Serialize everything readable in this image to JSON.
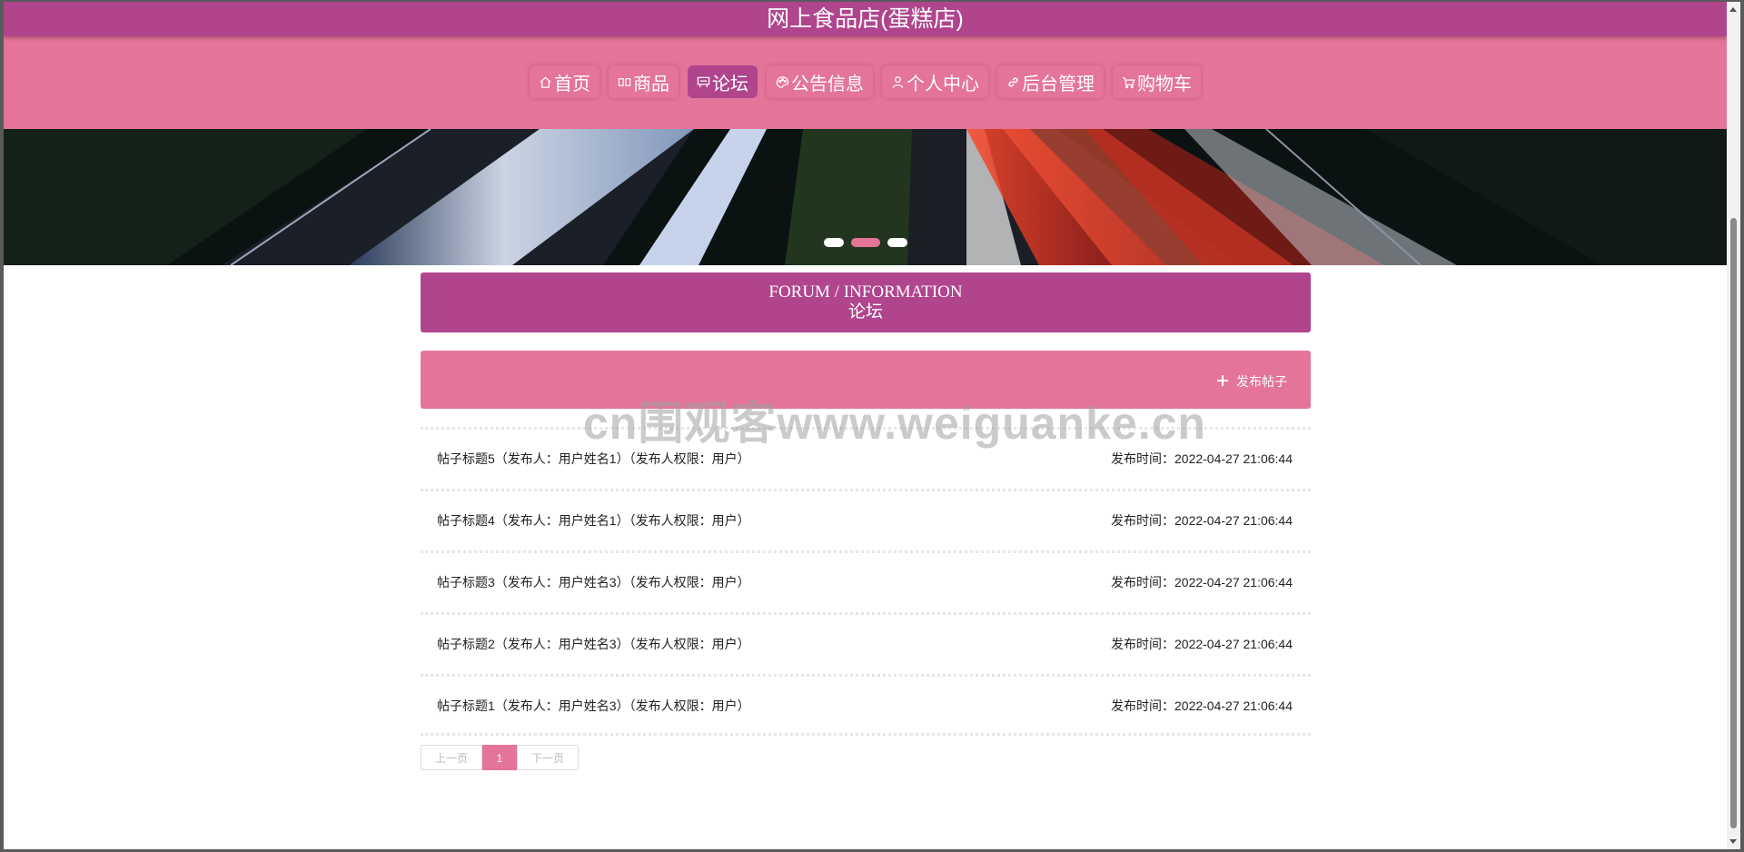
{
  "site": {
    "title": "网上食品店(蛋糕店)"
  },
  "nav": {
    "items": [
      {
        "label": "首页",
        "icon": "home-icon",
        "active": false
      },
      {
        "label": "商品",
        "icon": "goods-icon",
        "active": false
      },
      {
        "label": "论坛",
        "icon": "forum-icon",
        "active": true
      },
      {
        "label": "公告信息",
        "icon": "palette-icon",
        "active": false
      },
      {
        "label": "个人中心",
        "icon": "user-icon",
        "active": false
      },
      {
        "label": "后台管理",
        "icon": "link-icon",
        "active": false
      },
      {
        "label": "购物车",
        "icon": "cart-icon",
        "active": false
      }
    ]
  },
  "banner": {
    "slide_count": 3,
    "active_slide": 2
  },
  "section": {
    "title_en": "FORUM / INFORMATION",
    "title_cn": "论坛"
  },
  "actions": {
    "post_label": "发布帖子"
  },
  "posts": [
    {
      "title": "帖子标题5（发布人：用户姓名1）（发布人权限：用户）",
      "time": "发布时间：2022-04-27 21:06:44"
    },
    {
      "title": "帖子标题4（发布人：用户姓名1）（发布人权限：用户）",
      "time": "发布时间：2022-04-27 21:06:44"
    },
    {
      "title": "帖子标题3（发布人：用户姓名3）（发布人权限：用户）",
      "time": "发布时间：2022-04-27 21:06:44"
    },
    {
      "title": "帖子标题2（发布人：用户姓名3）（发布人权限：用户）",
      "time": "发布时间：2022-04-27 21:06:44"
    },
    {
      "title": "帖子标题1（发布人：用户姓名3）（发布人权限：用户）",
      "time": "发布时间：2022-04-27 21:06:44"
    }
  ],
  "pagination": {
    "prev_label": "上一页",
    "current_page": "1",
    "next_label": "下一页"
  },
  "watermark": "cn围观客www.weiguanke.cn",
  "colors": {
    "primary": "#b0458e",
    "accent": "#e47498"
  }
}
